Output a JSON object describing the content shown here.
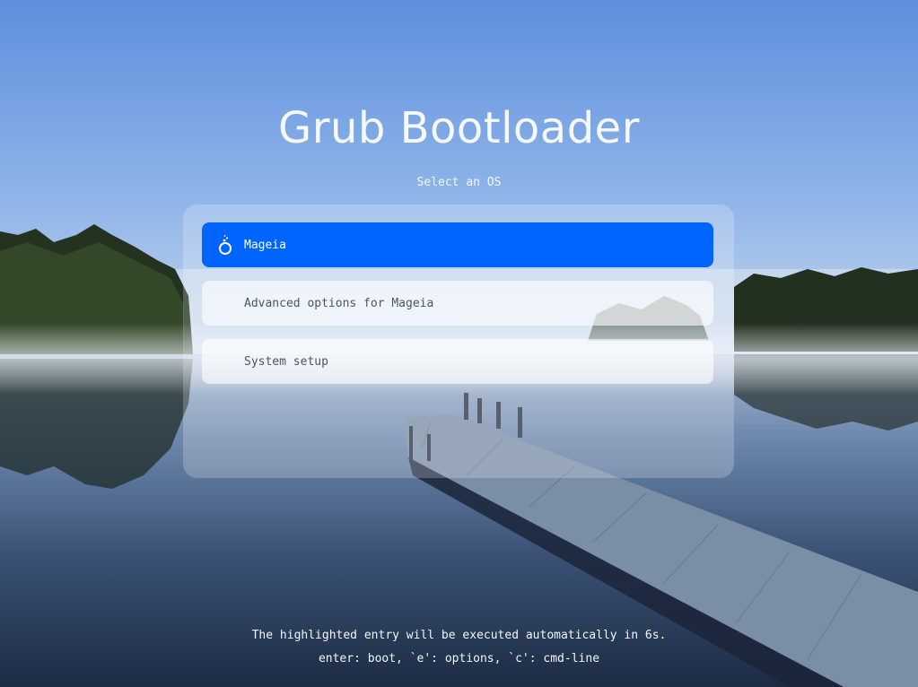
{
  "title": "Grub Bootloader",
  "subtitle": "Select an OS",
  "entries": [
    {
      "label": "Mageia",
      "icon": "mageia-logo-icon",
      "selected": true
    },
    {
      "label": "Advanced options for Mageia",
      "selected": false
    },
    {
      "label": "System setup",
      "selected": false
    }
  ],
  "footer": {
    "countdown": "The highlighted entry will be executed automatically in 6s.",
    "help": "enter: boot, `e': options, `c': cmd-line"
  },
  "colors": {
    "selected": "#0064fe",
    "sky": "#7aa6e8",
    "water": "#2a3e5c"
  }
}
